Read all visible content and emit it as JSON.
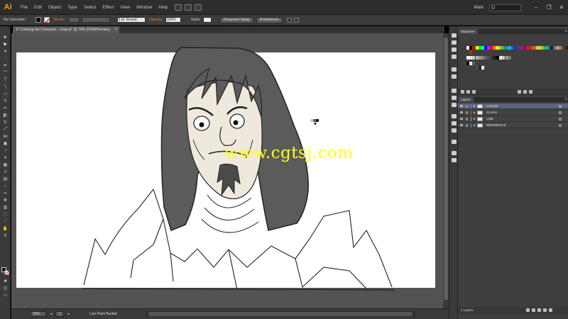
{
  "app": {
    "logo": "Ai"
  },
  "menu": [
    "File",
    "Edit",
    "Object",
    "Type",
    "Select",
    "Effect",
    "View",
    "Window",
    "Help"
  ],
  "user": {
    "name": "Mark"
  },
  "window_controls": [
    "–",
    "❐",
    "✕"
  ],
  "controlbar": {
    "selection": "No Selection",
    "stroke_label": "Stroke:",
    "brush_value": "3 pt. Round",
    "opacity_label": "Opacity:",
    "opacity_value": "100%",
    "style_label": "Style:",
    "doc_setup": "Document Setup",
    "preferences": "Preferences"
  },
  "document": {
    "tab_title": "17 Coloring the Character - Copy.ai* @ 74% (RGB/Preview)",
    "close": "×"
  },
  "canvas": {
    "watermark": "www.cgtsj.com"
  },
  "statusbar": {
    "zoom": "74%",
    "page": "1",
    "status": "Live Paint Bucket"
  },
  "panels": {
    "swatches": {
      "title": "Swatches",
      "menu": "≡"
    },
    "layers": {
      "title": "Layers",
      "menu": "≡",
      "items": [
        {
          "name": "COLOR",
          "color": "#4a7dd9",
          "selected": true
        },
        {
          "name": "CLEAN",
          "color": "#d94a4a",
          "selected": false
        },
        {
          "name": "LINE",
          "color": "#4ad94a",
          "selected": false
        },
        {
          "name": "REFERENCE",
          "color": "#4a7dd9",
          "selected": false
        }
      ],
      "count": "4 Layers"
    }
  },
  "colors": {
    "accent_orange": "#ff9a00",
    "skin": "#efe8dc",
    "hair": "#5b5b5b",
    "canvas_bg": "#535353",
    "watermark": "#ffff1a"
  }
}
